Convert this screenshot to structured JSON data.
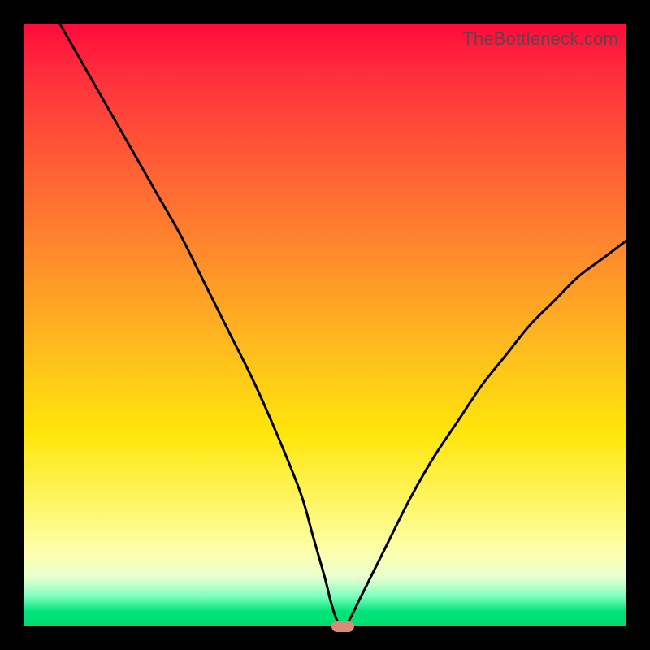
{
  "watermark": "TheBottleneck.com",
  "colors": {
    "gradient_top": "#ff0a3a",
    "gradient_mid1": "#ff8a2c",
    "gradient_mid2": "#ffe60a",
    "gradient_pale": "#fdffb0",
    "gradient_bottom": "#00db70",
    "curve": "#000000",
    "marker": "#d98b78",
    "frame": "#000000"
  },
  "chart_data": {
    "type": "line",
    "title": "",
    "xlabel": "",
    "ylabel": "",
    "xlim": [
      0,
      100
    ],
    "ylim": [
      0,
      100
    ],
    "series": [
      {
        "name": "bottleneck-curve",
        "x": [
          6,
          10,
          14,
          18,
          22,
          26,
          30,
          34,
          38,
          42,
          46,
          48,
          50,
          51,
          52,
          53,
          54,
          56,
          60,
          64,
          68,
          72,
          76,
          80,
          84,
          88,
          92,
          96,
          100
        ],
        "y": [
          100,
          93,
          86,
          79,
          72,
          65,
          57,
          49,
          41,
          32,
          22,
          15,
          8,
          4,
          1,
          0,
          1,
          5,
          13,
          21,
          28,
          34,
          40,
          45,
          50,
          54,
          58,
          61,
          64
        ]
      }
    ],
    "marker": {
      "x": 53,
      "y": 0
    },
    "notes": "V-shaped bottleneck curve over red-to-green vertical gradient; minimum near x≈53. Values estimated from pixels."
  }
}
